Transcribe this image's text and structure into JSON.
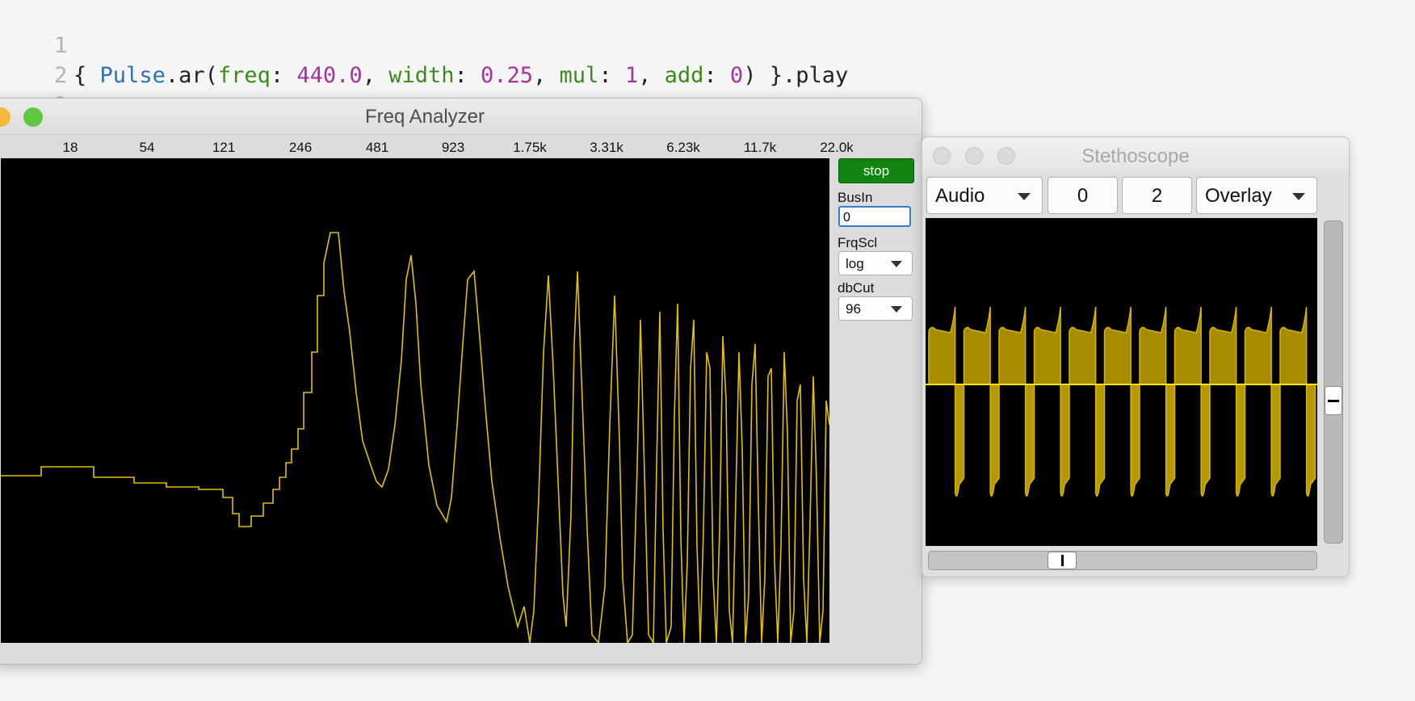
{
  "editor": {
    "line_numbers": [
      "1",
      "2",
      "3"
    ],
    "code": {
      "open_brace": "{ ",
      "class_name": "Pulse",
      "method": ".ar(",
      "arg1_key": "freq",
      "colon1": ": ",
      "arg1_val": "440.0",
      "sep1": ", ",
      "arg2_key": "width",
      "colon2": ": ",
      "arg2_val": "0.25",
      "sep2": ", ",
      "arg3_key": "mul",
      "colon3": ": ",
      "arg3_val": "1",
      "sep3": ", ",
      "arg4_key": "add",
      "colon4": ": ",
      "arg4_val": "0",
      "close": ") }.play"
    }
  },
  "freq_analyzer": {
    "title": "Freq Analyzer",
    "traffic_colors": [
      "#f5b93d",
      "#5fc843"
    ],
    "freq_ticks": [
      "18",
      "54",
      "121",
      "246",
      "481",
      "923",
      "1.75k",
      "3.31k",
      "6.23k",
      "11.7k",
      "22.0k"
    ],
    "stop_label": "stop",
    "busin_label": "BusIn",
    "busin_value": "0",
    "frqscl_label": "FrqScl",
    "frqscl_value": "log",
    "dbcut_label": "dbCut",
    "dbcut_value": "96",
    "trace_color": "#e3c000"
  },
  "stethoscope": {
    "title": "Stethoscope",
    "rate_select": "Audio",
    "bus_index": "0",
    "num_channels": "2",
    "view_select": "Overlay",
    "trace_color": "#d6b400"
  }
}
